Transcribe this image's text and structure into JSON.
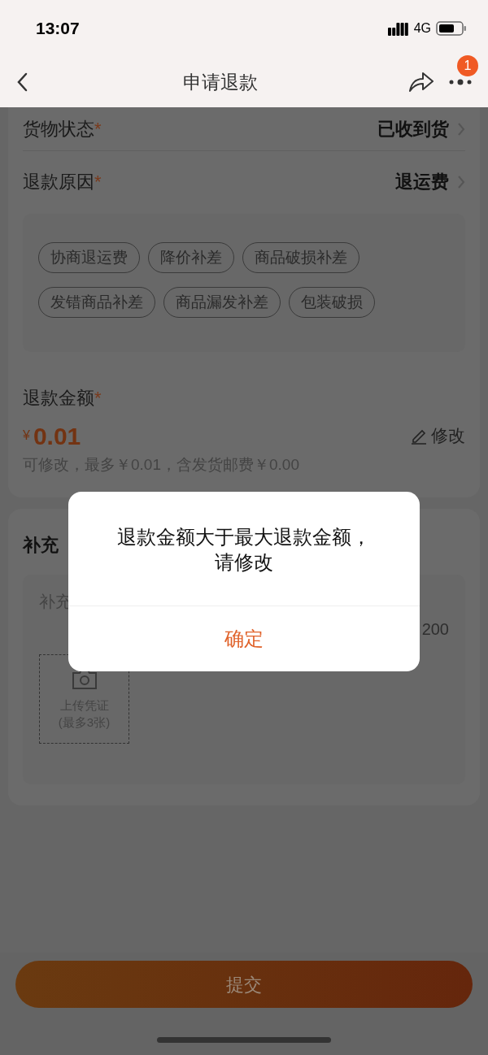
{
  "status_bar": {
    "time": "13:07",
    "network": "4G"
  },
  "nav": {
    "title": "申请退款",
    "badge": "1"
  },
  "rows": [
    {
      "label": "货物状态",
      "required": "*",
      "value": "已收到货"
    },
    {
      "label": "退款原因",
      "required": "*",
      "value": "退运费"
    }
  ],
  "reason_tags": [
    {
      "label": "协商退运费",
      "selected": false
    },
    {
      "label": "降价补差",
      "selected": false
    },
    {
      "label": "商品破损补差",
      "selected": false
    },
    {
      "label": "发错商品补差",
      "selected": false
    },
    {
      "label": "商品漏发补差",
      "selected": false
    },
    {
      "label": "包装破损",
      "selected": false
    }
  ],
  "amount": {
    "label": "退款金额",
    "required": "*",
    "currency": "¥",
    "value": "0.01",
    "edit": "修改",
    "note": "可修改，最多￥0.01，含发货邮费￥0.00"
  },
  "supplement": {
    "title": "补充",
    "placeholder": "补充",
    "counter": "200",
    "upload_label": "上传凭证",
    "upload_hint": "(最多3张)"
  },
  "submit": "提交",
  "dialog": {
    "message": "退款金额大于最大退款金额，请修改",
    "confirm": "确定"
  }
}
